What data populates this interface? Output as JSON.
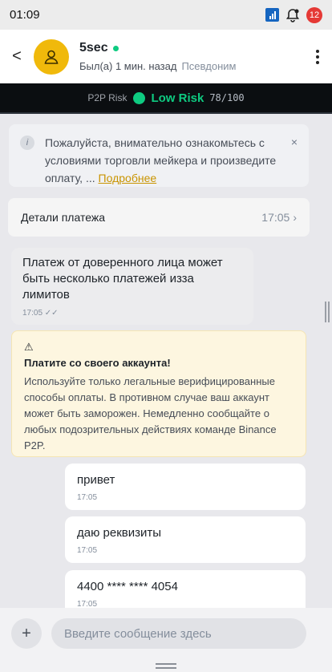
{
  "status_bar": {
    "time": "01:09",
    "notif_count": "12",
    "icons": [
      "signal-icon",
      "alarm-bell-icon"
    ]
  },
  "header": {
    "back_label": "<",
    "name": "5sec",
    "last_seen": "Был(а) 1 мин. назад",
    "pseudonym": "Псевдоним",
    "online_color": "#0ecb81",
    "avatar_color": "#f0b90b"
  },
  "risk": {
    "label": "P2P Risk",
    "level": "Low Risk",
    "score": "78/100",
    "color": "#0ecb81"
  },
  "notice": {
    "text": "Пожалуйста, внимательно ознакомьтесь с условиями торговли мейкера и произведите оплату, ...",
    "link": "Подробнее",
    "close": "×"
  },
  "payment_details": {
    "title": "Детали платежа",
    "time": "17:05",
    "chevron": "›"
  },
  "incoming": {
    "text": "Платеж от доверенного лица может быть несколько платежей изза лимитов",
    "time": "17:05 ✓✓"
  },
  "warning": {
    "icon": "⚠",
    "title": "Платите со своего аккаунта!",
    "body": "Используйте только легальные верифицированные способы оплаты. В противном случае ваш аккаунт может быть заморожен. Немедленно сообщайте о любых подозрительных действиях команде Binance P2P."
  },
  "outgoing": [
    {
      "text": "привет",
      "time": "17:05"
    },
    {
      "text": "даю реквизиты",
      "time": "17:05"
    },
    {
      "text": "4400 **** **** 4054",
      "time": "17:05"
    }
  ],
  "composer": {
    "plus": "+",
    "placeholder": "Введите сообщение здесь"
  }
}
